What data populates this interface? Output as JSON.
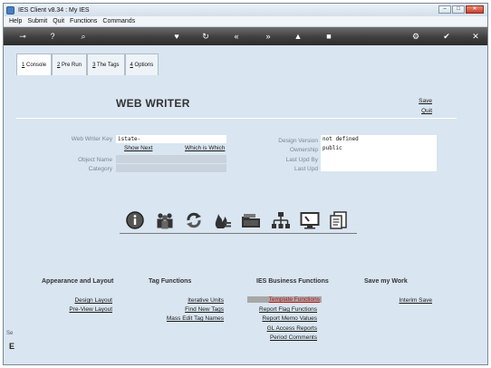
{
  "window": {
    "title": "IES Client v8.34 : My IES",
    "minimize": "–",
    "maximize": "□",
    "close": "✕"
  },
  "menu": [
    "Help",
    "Submit",
    "Quit",
    "Functions",
    "Commands"
  ],
  "toolbar": {
    "icons": [
      "key-icon",
      "help-icon",
      "search-icon",
      "heart-icon",
      "refresh-icon",
      "rewind-icon",
      "fast-forward-icon",
      "stop-icon",
      "square-icon",
      "settings-icon",
      "check-icon",
      "close-icon"
    ],
    "glyphs": [
      "⊸",
      "?",
      "⌕",
      "♥",
      "↻",
      "«",
      "»",
      "▲",
      "■",
      "⚙",
      "✔",
      "✕"
    ]
  },
  "tabs": [
    {
      "key": "1",
      "label": " Console"
    },
    {
      "key": "2",
      "label": " Pre Run"
    },
    {
      "key": "3",
      "label": " The Tags"
    },
    {
      "key": "4",
      "label": " Options"
    }
  ],
  "header": {
    "title": "WEB WRITER",
    "save": "Save",
    "quit": "Quit"
  },
  "form": {
    "key_label": "Web Writer Key",
    "key_value": "istate-",
    "show_next": "Show Next",
    "which_is_which": "Which is Which",
    "object_label": "Object Name",
    "object_value": "",
    "category_label": "Category",
    "category_value": "",
    "design_version_label": "Design Version",
    "design_version_value": "not defined",
    "ownership_label": "Ownership",
    "ownership_value": "public",
    "last_upd_by_label": "Last Upd By",
    "last_upd_by_value": "",
    "last_upd_label": "Last Upd",
    "last_upd_value": ""
  },
  "icon_row": [
    "info-icon",
    "users-icon",
    "cycle-icon",
    "fire-icon",
    "folder-icon",
    "hierarchy-icon",
    "monitor-icon",
    "document-icon"
  ],
  "sections": {
    "appearance": {
      "title": "Appearance and Layout",
      "links": [
        "Design Layout",
        "Pre-View Layout"
      ]
    },
    "tag": {
      "title": "Tag Functions",
      "links": [
        "Iterative Units",
        "Find New Tags",
        "Mass Edit Tag Names"
      ]
    },
    "business": {
      "title": "IES Business Functions",
      "links": [
        "Template Functions",
        "Report Flag Functions",
        "Report Memo Values",
        "GL Access Reports",
        "Period Comments"
      ]
    },
    "save": {
      "title": "Save my Work",
      "links": [
        "Interim Save"
      ]
    }
  },
  "side": {
    "text": "Se",
    "letter": "E"
  },
  "colors": {
    "highlight_text": "#c01414",
    "highlight_bg": "#a7a7a7",
    "background": "#d9e5f0"
  }
}
